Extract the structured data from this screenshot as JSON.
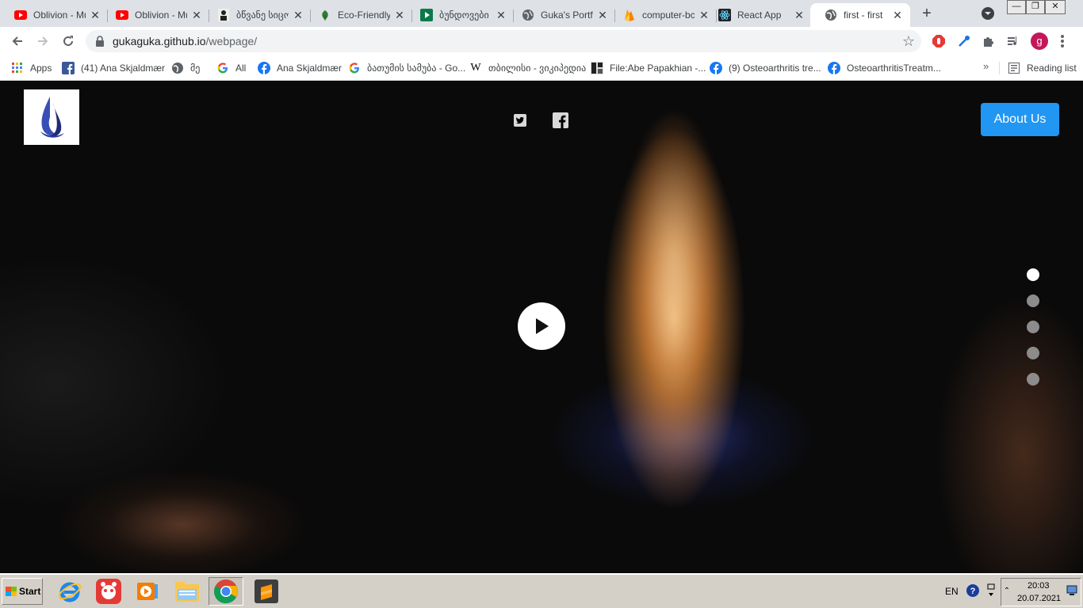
{
  "browser": {
    "tabs": [
      {
        "title": "Oblivion - Mu",
        "icon": "youtube-icon"
      },
      {
        "title": "Oblivion - Mu",
        "icon": "youtube-icon"
      },
      {
        "title": "ბწვანე სიცო",
        "icon": "person-icon"
      },
      {
        "title": "Eco-Friendly",
        "icon": "leaf-icon"
      },
      {
        "title": "ბუნდოვები",
        "icon": "play-green-icon"
      },
      {
        "title": "Guka's Portfo",
        "icon": "globe-icon"
      },
      {
        "title": "computer-bc",
        "icon": "firebase-icon"
      },
      {
        "title": "React App",
        "icon": "react-icon"
      },
      {
        "title": "first - first",
        "icon": "globe-icon",
        "active": true
      }
    ],
    "url_host": "gukaguka.github.io",
    "url_path": "/webpage/",
    "profile_initial": "g",
    "bookmarks": [
      {
        "label": "Apps",
        "icon": "apps-grid-icon"
      },
      {
        "label": "(41) Ana Skjaldmær",
        "icon": "facebook-icon"
      },
      {
        "label": "მე",
        "icon": "globe-icon"
      },
      {
        "label": "All",
        "icon": "google-icon"
      },
      {
        "label": "Ana Skjaldmær",
        "icon": "facebook-icon"
      },
      {
        "label": "ბათუმის სამუბა - Go...",
        "icon": "google-icon"
      },
      {
        "label": "თბილისი - ვიკიპედია",
        "icon": "wikipedia-icon"
      },
      {
        "label": "File:Abe Papakhian -...",
        "icon": "image-icon"
      },
      {
        "label": "(9) Osteoarthritis tre...",
        "icon": "facebook-icon"
      },
      {
        "label": "OsteoarthritisTreatm...",
        "icon": "facebook-icon"
      }
    ],
    "bookmarks_overflow": "»",
    "reading_list": "Reading list"
  },
  "page": {
    "about_button": "About Us",
    "slider_dots": 5,
    "active_dot": 0
  },
  "taskbar": {
    "start_label": "Start",
    "language": "EN",
    "time": "20:03",
    "date": "20.07.2021"
  },
  "colors": {
    "accent": "#2196f3",
    "tabstrip": "#dee1e6",
    "taskbar": "#d4d0c8"
  }
}
